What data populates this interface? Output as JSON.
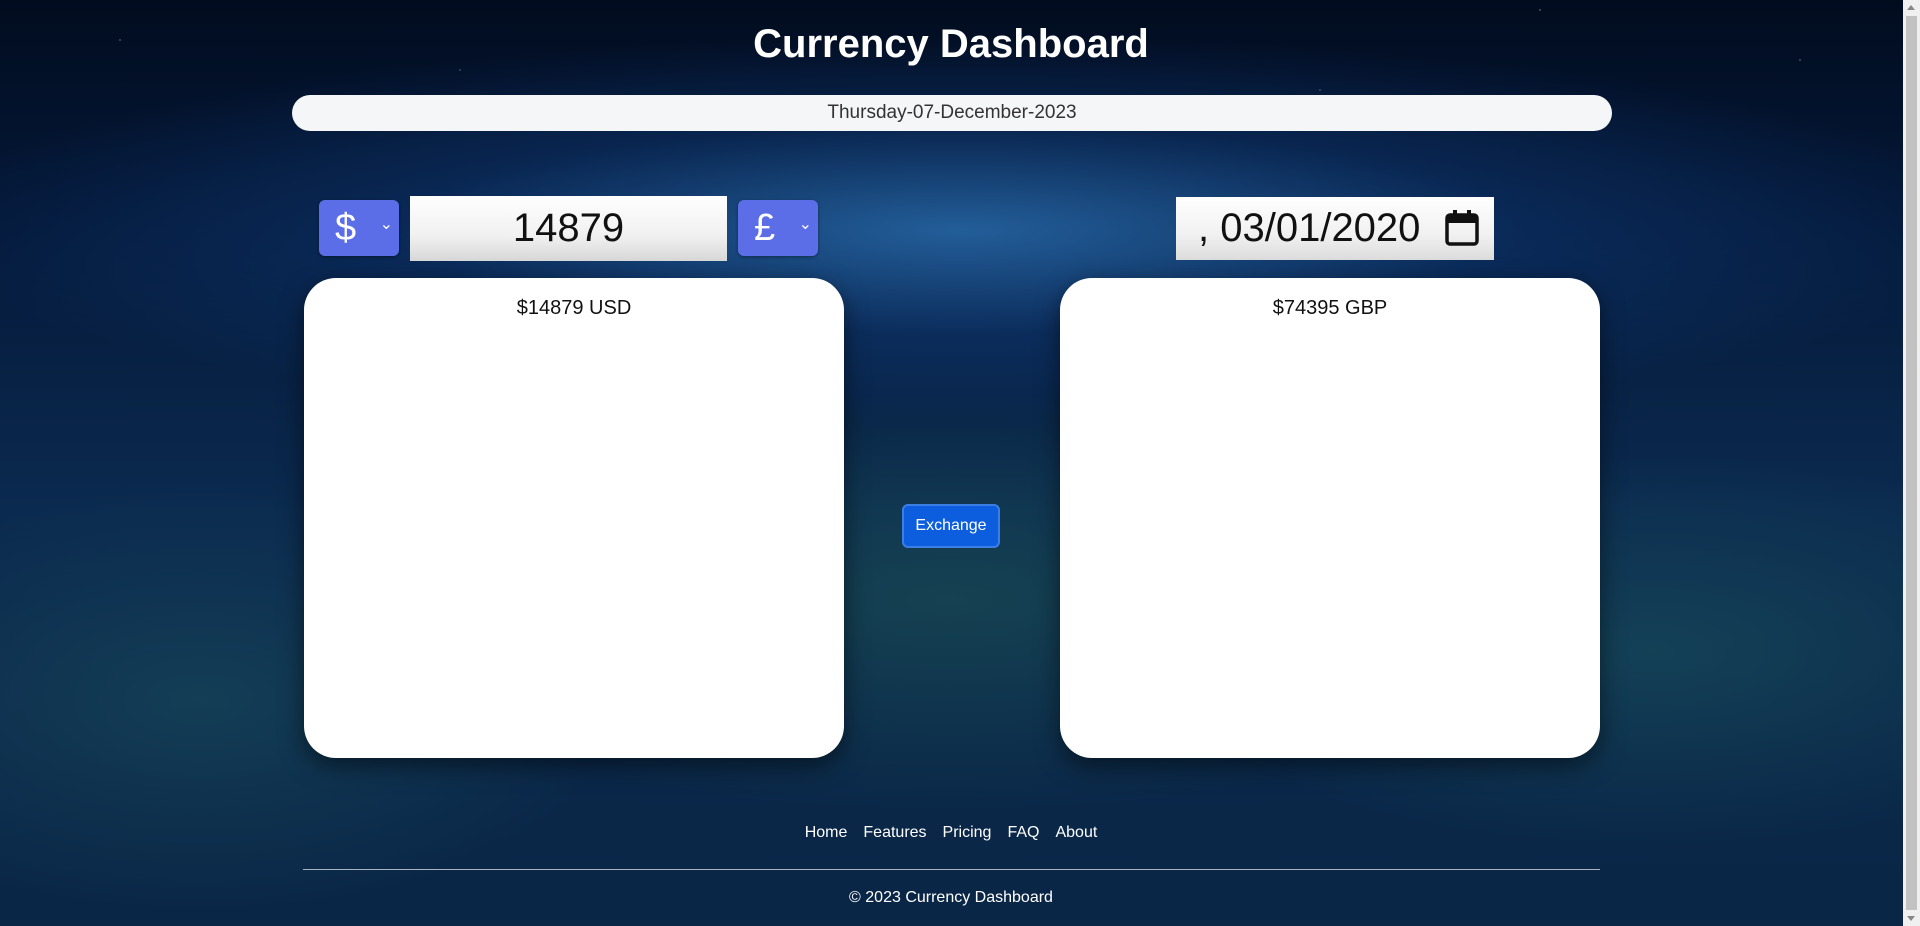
{
  "header": {
    "title": "Currency Dashboard"
  },
  "date_bar": {
    "text": "Thursday-07-December-2023"
  },
  "converter": {
    "from_currency": "$",
    "to_currency": "£",
    "amount": "14879",
    "date_value": ", 03/01/2020",
    "exchange_label": "Exchange"
  },
  "cards": {
    "from_value": "$14879 USD",
    "to_value": "$74395 GBP"
  },
  "footer": {
    "nav": [
      "Home",
      "Features",
      "Pricing",
      "FAQ",
      "About"
    ],
    "copyright": "© 2023 Currency Dashboard"
  },
  "icons": {
    "calendar": "calendar-icon",
    "chevron": "chevron-down-icon"
  },
  "colors": {
    "select_bg": "#5b6ee8",
    "button_bg": "#0d5ede"
  }
}
